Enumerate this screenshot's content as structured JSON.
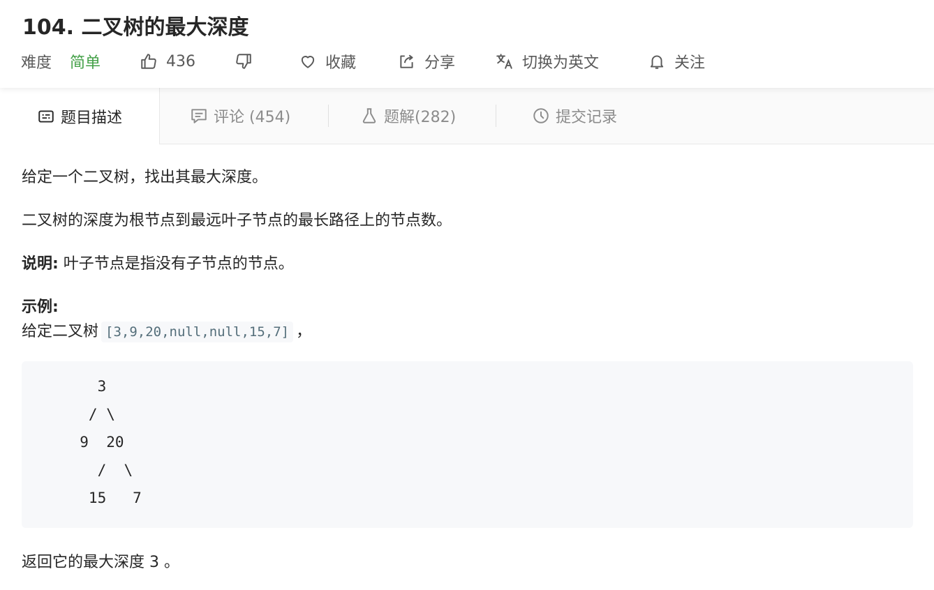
{
  "problem": {
    "title": "104. 二叉树的最大深度",
    "difficulty_label": "难度",
    "difficulty": "简单",
    "likes": "436",
    "favorite_label": "收藏",
    "share_label": "分享",
    "switch_lang_label": "切换为英文",
    "follow_label": "关注"
  },
  "tabs": [
    {
      "label": "题目描述",
      "icon": "description-icon"
    },
    {
      "label": "评论 (454)",
      "icon": "comment-icon"
    },
    {
      "label": "题解(282)",
      "icon": "flask-icon"
    },
    {
      "label": "提交记录",
      "icon": "clock-icon"
    }
  ],
  "description": {
    "line1": "给定一个二叉树，找出其最大深度。",
    "line2": "二叉树的深度为根节点到最远叶子节点的最长路径上的节点数。",
    "note_label": "说明:",
    "note_text": " 叶子节点是指没有子节点的节点。",
    "example_label": "示例:",
    "example_prefix": "给定二叉树",
    "example_code": "[3,9,20,null,null,15,7]",
    "example_suffix": "，",
    "tree_lines": [
      "    3",
      "   / \\",
      "  9  20",
      "    /  \\",
      "   15   7"
    ],
    "result": "返回它的最大深度 3 。"
  },
  "colors": {
    "difficulty_easy": "#43a047",
    "text_primary": "#262626",
    "text_secondary": "#595959",
    "code_bg": "#f7f8fa"
  }
}
